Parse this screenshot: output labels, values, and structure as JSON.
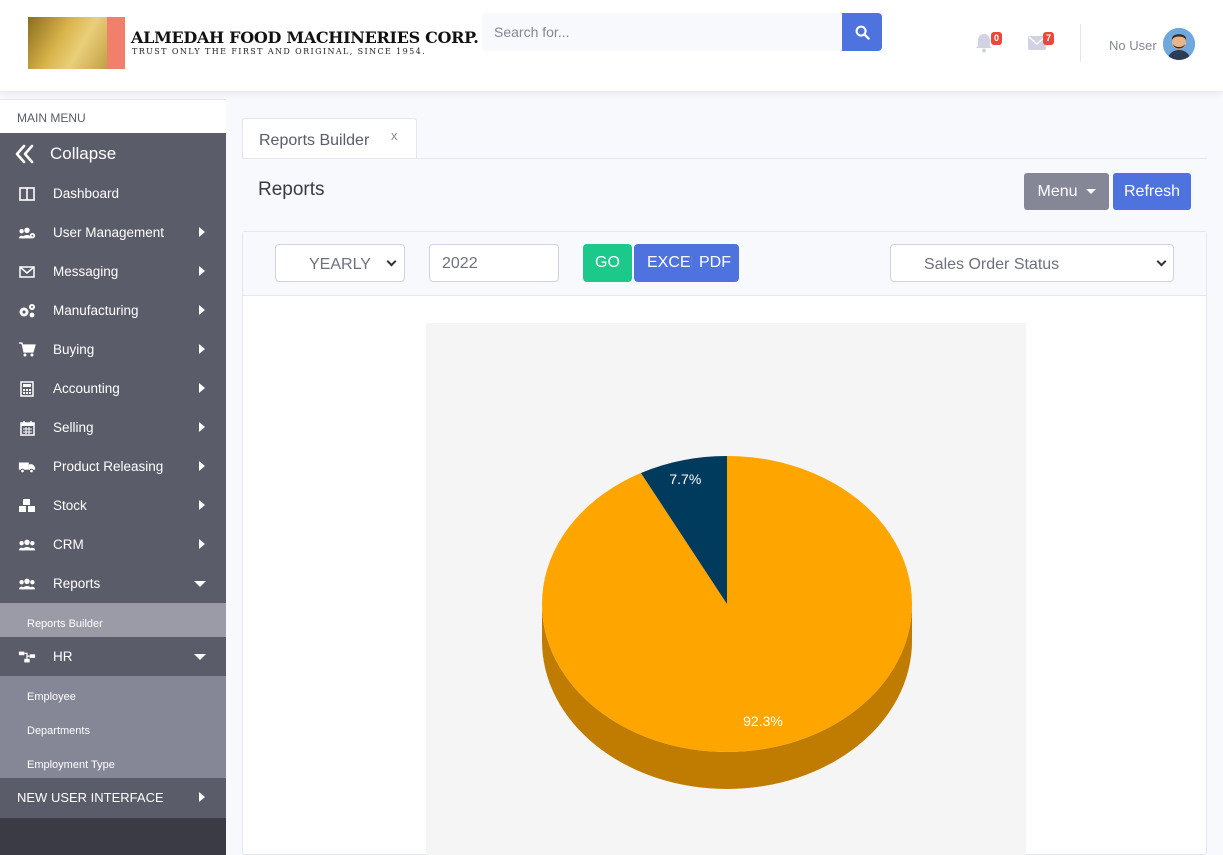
{
  "header": {
    "company_name": "ALMEDAH FOOD MACHINERIES CORP.",
    "tagline": "TRUST ONLY THE FIRST AND ORIGINAL, SINCE 1954.",
    "search_placeholder": "Search for...",
    "alerts_count": "0",
    "messages_count": "7",
    "user_name": "No User"
  },
  "sidebar": {
    "section_label": "MAIN MENU",
    "collapse_label": "Collapse",
    "items": [
      {
        "label": "Dashboard",
        "icon": "columns-icon"
      },
      {
        "label": "User Management",
        "icon": "users-cog-icon"
      },
      {
        "label": "Messaging",
        "icon": "envelope-icon"
      },
      {
        "label": "Manufacturing",
        "icon": "cogs-icon"
      },
      {
        "label": "Buying",
        "icon": "cart-icon"
      },
      {
        "label": "Accounting",
        "icon": "calculator-icon"
      },
      {
        "label": "Selling",
        "icon": "calendar-icon"
      },
      {
        "label": "Product Releasing",
        "icon": "truck-icon"
      },
      {
        "label": "Stock",
        "icon": "boxes-icon"
      },
      {
        "label": "CRM",
        "icon": "users-icon"
      },
      {
        "label": "Reports",
        "icon": "users-icon"
      }
    ],
    "reports_sub": [
      "Reports Builder"
    ],
    "hr_label": "HR",
    "hr_sub": [
      "Employee",
      "Departments",
      "Employment Type"
    ],
    "new_ui_label": "NEW USER INTERFACE"
  },
  "tab": {
    "label": "Reports Builder",
    "close": "x"
  },
  "page": {
    "title": "Reports",
    "menu_button": "Menu",
    "refresh_button": "Refresh"
  },
  "filters": {
    "period": "YEARLY",
    "year": "2022",
    "go": "GO",
    "excel": "EXCEL",
    "pdf": "PDF",
    "report": "Sales Order Status"
  },
  "chart_data": {
    "type": "pie",
    "slices": [
      {
        "value": 92.3,
        "label": "92.3%",
        "color": "#FFA500"
      },
      {
        "value": 7.7,
        "label": "7.7%",
        "color": "#003A5D"
      }
    ]
  },
  "colors": {
    "primary": "#4e73df",
    "success": "#1cc88a",
    "secondary": "#858796",
    "sidebar": "#5a5c69"
  }
}
